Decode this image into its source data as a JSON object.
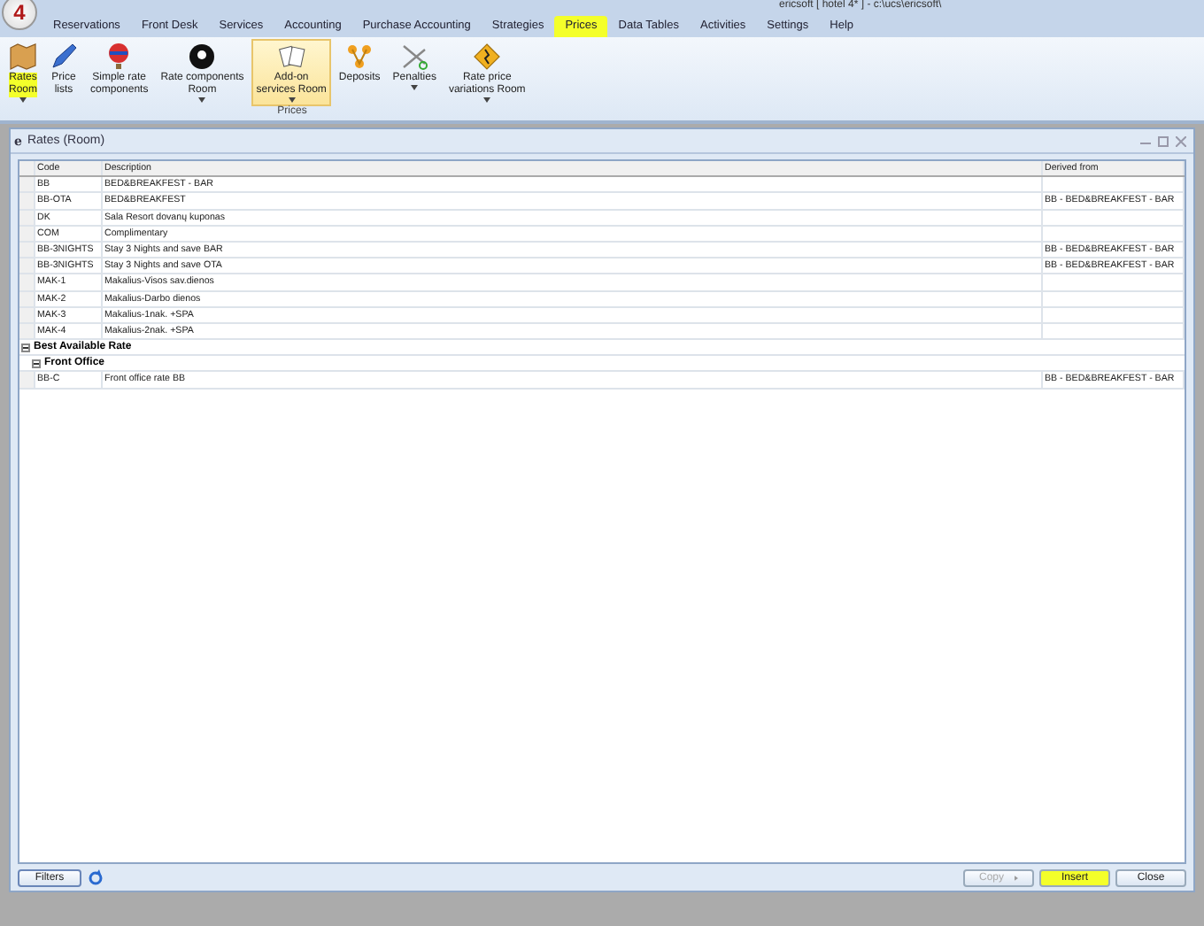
{
  "window": {
    "title": "ericsoft [ hotel 4* ] - c:\\ucs\\ericsoft\\",
    "logo": "4"
  },
  "menu_tabs": [
    {
      "label": "Reservations",
      "selected": false,
      "highlighted": false
    },
    {
      "label": "Front Desk",
      "selected": false,
      "highlighted": false
    },
    {
      "label": "Services",
      "selected": false,
      "highlighted": false
    },
    {
      "label": "Accounting",
      "selected": false,
      "highlighted": false
    },
    {
      "label": "Purchase Accounting",
      "selected": false,
      "highlighted": false
    },
    {
      "label": "Strategies",
      "selected": false,
      "highlighted": false
    },
    {
      "label": "Prices",
      "selected": true,
      "highlighted": true
    },
    {
      "label": "Data Tables",
      "selected": false,
      "highlighted": false
    },
    {
      "label": "Activities",
      "selected": false,
      "highlighted": false
    },
    {
      "label": "Settings",
      "selected": false,
      "highlighted": false
    },
    {
      "label": "Help",
      "selected": false,
      "highlighted": false
    }
  ],
  "ribbon": {
    "group_label": "Prices",
    "buttons": [
      {
        "kind": "map",
        "label": "Rates\nRoom",
        "dropdown": true,
        "highlighted": true,
        "selected": false
      },
      {
        "kind": "pen",
        "label": "Price\nlists",
        "dropdown": false,
        "highlighted": false,
        "selected": false
      },
      {
        "kind": "balloon",
        "label": "Simple rate\ncomponents",
        "dropdown": false,
        "highlighted": false,
        "selected": false
      },
      {
        "kind": "ball",
        "label": "Rate components\nRoom",
        "dropdown": true,
        "highlighted": false,
        "selected": false
      },
      {
        "kind": "cards",
        "label": "Add-on\nservices Room",
        "dropdown": true,
        "highlighted": false,
        "selected": true
      },
      {
        "kind": "deposit",
        "label": "Deposits",
        "dropdown": false,
        "highlighted": false,
        "selected": false
      },
      {
        "kind": "scissors",
        "label": "Penalties",
        "dropdown": true,
        "highlighted": false,
        "selected": false
      },
      {
        "kind": "sign",
        "label": "Rate price\nvariations Room",
        "dropdown": true,
        "highlighted": false,
        "selected": false
      }
    ]
  },
  "document": {
    "icon": "e",
    "title": "Rates (Room)",
    "columns": [
      "Code",
      "Description",
      "Derived from"
    ],
    "rows": [
      {
        "kind": "rate",
        "code": "BB",
        "description": "BED&BREAKFEST - BAR",
        "derived_from": ""
      },
      {
        "kind": "rate",
        "code": "BB-OTA",
        "description": "BED&BREAKFEST",
        "derived_from": "BB - BED&BREAKFEST - BAR"
      },
      {
        "kind": "rate",
        "code": "DK",
        "description": "Sala Resort dovanų kuponas",
        "derived_from": ""
      },
      {
        "kind": "rate",
        "code": "COM",
        "description": "Complimentary",
        "derived_from": ""
      },
      {
        "kind": "rate",
        "code": "BB-3NIGHTS",
        "description": "Stay 3 Nights and save BAR",
        "derived_from": "BB - BED&BREAKFEST - BAR"
      },
      {
        "kind": "rate",
        "code": "BB-3NIGHTS",
        "description": "Stay 3 Nights and save OTA",
        "derived_from": "BB - BED&BREAKFEST - BAR"
      },
      {
        "kind": "rate",
        "code": "MAK-1",
        "description": "Makalius-Visos sav.dienos",
        "derived_from": ""
      },
      {
        "kind": "rate",
        "code": "MAK-2",
        "description": "Makalius-Darbo dienos",
        "derived_from": ""
      },
      {
        "kind": "rate",
        "code": "MAK-3",
        "description": "Makalius-1nak. +SPA",
        "derived_from": ""
      },
      {
        "kind": "rate",
        "code": "MAK-4",
        "description": "Makalius-2nak. +SPA",
        "derived_from": ""
      },
      {
        "kind": "group",
        "label": "Best Available Rate",
        "expanded": true,
        "children": [
          {
            "kind": "group",
            "label": "Front Office",
            "expanded": true,
            "children": [
              {
                "kind": "rate",
                "code": "BB-C",
                "description": "Front office rate BB",
                "derived_from": "BB - BED&BREAKFEST - BAR"
              }
            ]
          }
        ]
      }
    ]
  },
  "footer": {
    "filters": "Filters",
    "buttons": [
      {
        "label": "Copy",
        "disabled": true,
        "highlighted": false,
        "arrow": true
      },
      {
        "label": "Insert",
        "disabled": false,
        "highlighted": true,
        "arrow": false
      },
      {
        "label": "Close",
        "disabled": false,
        "highlighted": false,
        "arrow": false
      }
    ]
  }
}
